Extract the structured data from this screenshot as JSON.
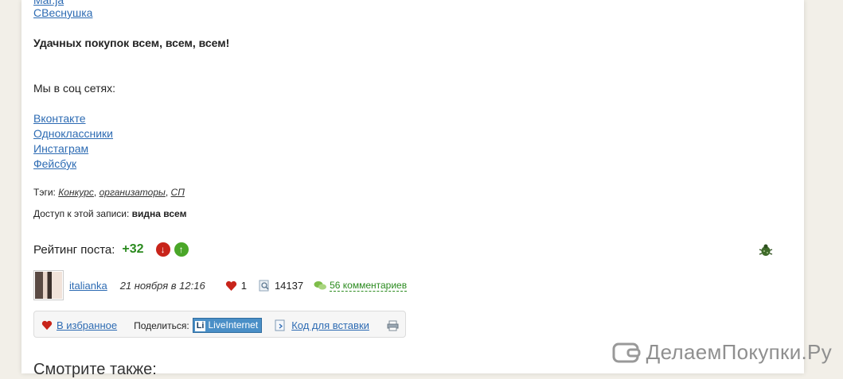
{
  "users": {
    "top_partial": "Mar.ja",
    "svesnushka": "СВеснушка"
  },
  "greeting": "Удачных покупок всем, всем, всем!",
  "social": {
    "heading": "Мы в соц сетях:",
    "links": [
      "Вконтакте",
      "Одноклассники",
      "Инстаграм",
      "Фейсбук"
    ]
  },
  "tags": {
    "label": "Тэги:",
    "items": [
      "Конкурс",
      "организаторы",
      "СП"
    ],
    "separator": ","
  },
  "access": {
    "label": "Доступ к этой записи:",
    "value": "видна всем"
  },
  "rating": {
    "label": "Рейтинг поста:",
    "value": "+32"
  },
  "post_meta": {
    "author": "italianka",
    "date": "21 ноября в 12:16",
    "likes": "1",
    "views": "14137",
    "comments": "56 комментариев"
  },
  "share": {
    "favorite": "В избранное",
    "share_label": "Поделиться:",
    "liveinternet_icon": "Li",
    "liveinternet": "LiveInternet",
    "embed_code": "Код для вставки"
  },
  "see_also": "Смотрите также:",
  "watermark": "ДелаемПокупки.Ру",
  "icons": {
    "bug": "bug-icon",
    "heart": "heart-icon",
    "views": "magnifier-icon",
    "comments": "speech-bubbles-icon",
    "print": "printer-icon"
  },
  "colors": {
    "link": "#2d6bb3",
    "rating_positive": "#2a8a1e",
    "vote_down": "#c8241a",
    "vote_up": "#4aa628",
    "background": "#f2efe8"
  }
}
